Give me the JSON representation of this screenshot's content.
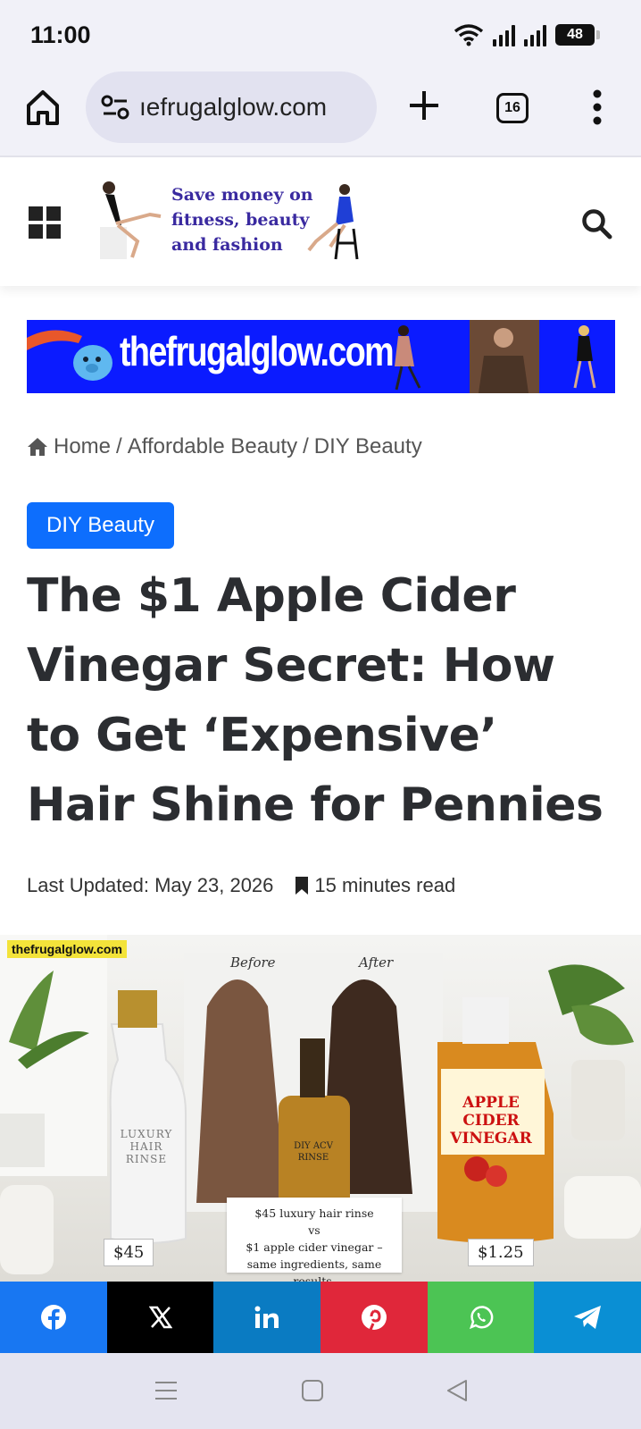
{
  "status_bar": {
    "time": "11:00",
    "battery": "48"
  },
  "browser": {
    "url": "ıefrugalglow.com",
    "tab_count": "16"
  },
  "site": {
    "tagline_line1": "Save money on",
    "tagline_line2": "fitness, beauty",
    "tagline_line3": "and fashion",
    "banner_text": "thefrugalglow.com"
  },
  "breadcrumb": {
    "home": "Home",
    "sep1": "/",
    "category": "Affordable Beauty",
    "sep2": "/",
    "subcategory": "DIY Beauty"
  },
  "article": {
    "category_badge": "DIY Beauty",
    "title": "The $1 Apple Cider Vinegar Secret: How to Get ‘Expensive’ Hair Shine for Pennies",
    "last_updated": "Last Updated: May 23, 2026",
    "read_time": "15 minutes read"
  },
  "featured_image": {
    "watermark": "thefrugalglow.com",
    "label_before": "Before",
    "label_after": "After",
    "luxury_label": "LUXURY HAIR RINSE",
    "diy_label": "DIY ACV RINSE",
    "acv_label": "APPLE CIDER VINEGAR",
    "caption_line1": "$45 luxury hair rinse",
    "caption_line2": "vs",
    "caption_line3": "$1 apple cider vinegar –",
    "caption_line4": "same ingredients, same results.",
    "price_left": "$45",
    "price_right": "$1.25"
  },
  "share": [
    "facebook-icon",
    "x-icon",
    "linkedin-icon",
    "pinterest-icon",
    "whatsapp-icon",
    "telegram-icon"
  ],
  "colors": {
    "badge": "#0d6efd",
    "banner": "#0b1bff",
    "facebook": "#1877f2",
    "x": "#000000",
    "linkedin": "#0a7bc2",
    "pinterest": "#e0273a",
    "whatsapp": "#4cc454",
    "telegram": "#0a8fd4"
  }
}
